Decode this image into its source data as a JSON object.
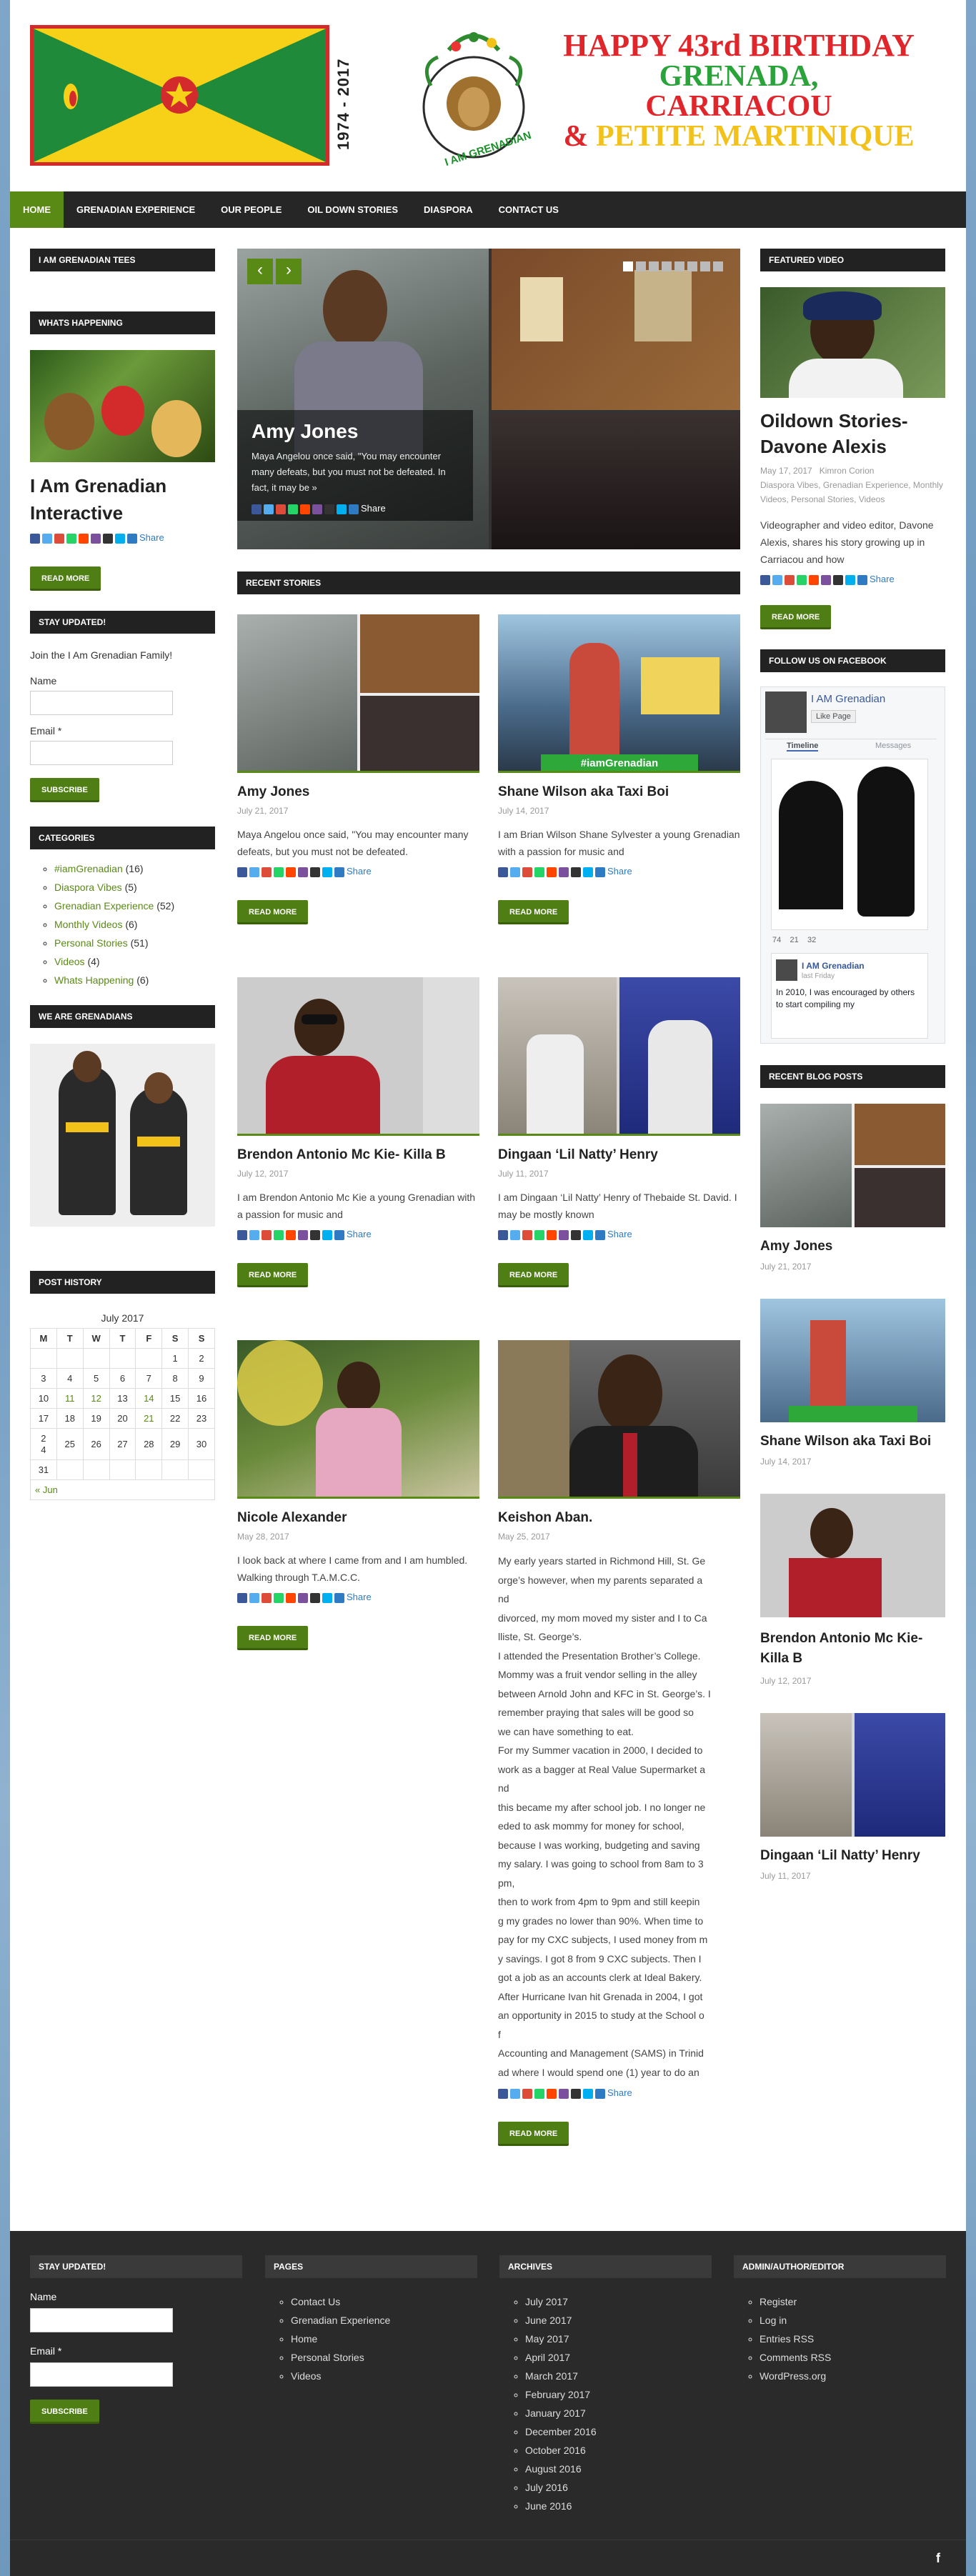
{
  "header": {
    "years": "1974 - 2017",
    "logo_text": "I AM GRENADIAN",
    "bday_line1": "HAPPY 43rd BIRTHDAY",
    "bday_line2": "GRENADA,",
    "bday_line3": "CARRIACOU",
    "bday_amp": "&",
    "bday_line4": "PETITE MARTINIQUE"
  },
  "nav": [
    "HOME",
    "GRENADIAN EXPERIENCE",
    "OUR PEOPLE",
    "OIL DOWN STORIES",
    "DIASPORA",
    "CONTACT US"
  ],
  "left": {
    "tees_title": "I AM GRENADIAN TEES",
    "happening_title": "WHATS HAPPENING",
    "happening_post": "I Am Grenadian Interactive",
    "share": "Share",
    "read_more": "READ MORE",
    "stay_title": "STAY UPDATED!",
    "stay_text": "Join the I Am Grenadian Family!",
    "name_label": "Name",
    "email_label": "Email *",
    "subscribe": "SUBSCRIBE",
    "categories_title": "CATEGORIES",
    "categories": [
      {
        "name": "#iamGrenadian",
        "count": "(16)"
      },
      {
        "name": "Diaspora Vibes",
        "count": "(5)"
      },
      {
        "name": "Grenadian Experience",
        "count": "(52)"
      },
      {
        "name": "Monthly Videos",
        "count": "(6)"
      },
      {
        "name": "Personal Stories",
        "count": "(51)"
      },
      {
        "name": "Videos",
        "count": "(4)"
      },
      {
        "name": "Whats Happening",
        "count": "(6)"
      }
    ],
    "we_are_title": "WE ARE GRENADIANS",
    "post_history_title": "POST HISTORY",
    "calendar": {
      "caption": "July 2017",
      "days": [
        "M",
        "T",
        "W",
        "T",
        "F",
        "S",
        "S"
      ],
      "rows": [
        [
          "",
          "",
          "",
          "",
          "",
          "1",
          "2"
        ],
        [
          "3",
          "4",
          "5",
          "6",
          "7",
          "8",
          "9"
        ],
        [
          "10",
          "11",
          "12",
          "13",
          "14",
          "15",
          "16"
        ],
        [
          "17",
          "18",
          "19",
          "20",
          "21",
          "22",
          "23"
        ],
        [
          "2\n4",
          "25",
          "26",
          "27",
          "28",
          "29",
          "30"
        ],
        [
          "31",
          "",
          "",
          "",
          "",
          "",
          ""
        ]
      ],
      "prev": "« Jun"
    }
  },
  "slider": {
    "title": "Amy Jones",
    "excerpt": "Maya Angelou once said, \"You may encounter many defeats, but you must not be defeated. In fact, it may be »",
    "share": "Share",
    "prev": "‹",
    "next": "›"
  },
  "recent_title": "RECENT STORIES",
  "posts": [
    {
      "title": "Amy Jones",
      "date": "July 21, 2017",
      "excerpt": "Maya Angelou once said, \"You may encounter many defeats, but you must not be defeated.",
      "caption": ""
    },
    {
      "title": "Shane Wilson aka Taxi Boi",
      "date": "July 14, 2017",
      "excerpt": "I am Brian Wilson Shane Sylvester a young Grenadian with a passion for music and",
      "caption": "#iamGrenadian"
    },
    {
      "title": "Brendon Antonio Mc Kie- Killa B",
      "date": "July 12, 2017",
      "excerpt": "I am Brendon Antonio Mc Kie a young Grenadian with a passion for music and",
      "caption": ""
    },
    {
      "title": "Dingaan ‘Lil Natty’ Henry",
      "date": "July 11, 2017",
      "excerpt": "I am Dingaan ‘Lil Natty’ Henry of Thebaide St. David. I may be mostly known",
      "caption": ""
    },
    {
      "title": "Nicole Alexander",
      "date": "May 28, 2017",
      "excerpt": "I look back at where I came from and I am humbled. Walking through T.A.M.C.C.",
      "caption": ""
    },
    {
      "title": "Keishon Aban.",
      "date": "May 25, 2017",
      "excerpt": "",
      "caption": ""
    }
  ],
  "keishon_lines": [
    "My early years started in Richmond Hill, St. Ge",
    "orge’s however, when my parents separated a",
    "nd",
    "divorced, my mom moved my sister and I to Ca",
    "lliste, St. George’s.",
    "I attended the Presentation Brother’s College.",
    "Mommy was a fruit vendor selling in the alley",
    "between Arnold John and KFC in St. George’s. I",
    " remember praying that sales will be good so",
    "we can have something to eat.",
    "For my Summer vacation in 2000, I decided to",
    "work as a bagger at Real Value Supermarket a",
    "nd",
    "this became my after school job. I no longer ne",
    "eded to ask mommy for money for school,",
    "because I was working, budgeting and saving",
    "my salary. I was going to school from 8am to 3",
    "pm,",
    "then to work from 4pm to 9pm and still keepin",
    "g my grades no lower than 90%. When time to",
    "pay for my CXC subjects, I used money from m",
    "y savings. I got 8 from 9 CXC subjects. Then I",
    "got a job as an accounts clerk at Ideal Bakery.",
    "After Hurricane Ivan hit Grenada in 2004, I got",
    "an opportunity in 2015 to study at the School o",
    "f",
    "Accounting and Management (SAMS) in Trinid",
    "ad where I would spend one (1) year to do an"
  ],
  "right": {
    "featured_title": "FEATURED VIDEO",
    "featured_post": "Oildown Stories- Davone Alexis",
    "featured_date": "May 17, 2017",
    "featured_author": "Kimron Corion",
    "featured_cats": "Diaspora Vibes, Grenadian Experience, Monthly Videos, Personal Stories, Videos",
    "featured_excerpt": "Videographer and video editor, Davone Alexis, shares his story growing up in Carriacou and how",
    "follow_title": "FOLLOW US ON FACEBOOK",
    "fb_page": "I AM Grenadian",
    "fb_like": "Like Page",
    "fb_tab1": "Timeline",
    "fb_tab2": "Messages",
    "fb_stats": [
      "74",
      "21",
      "32"
    ],
    "fb_post_name": "I AM Grenadian",
    "fb_post_time": "last Friday",
    "fb_post_text": "In 2010, I was encouraged by others to start compiling my",
    "recent_blog_title": "RECENT BLOG POSTS",
    "blog": [
      {
        "title": "Amy Jones",
        "date": "July 21, 2017"
      },
      {
        "title": "Shane Wilson aka Taxi Boi",
        "date": "July 14, 2017"
      },
      {
        "title": "Brendon Antonio Mc Kie- Killa B",
        "date": "July 12, 2017"
      },
      {
        "title": "Dingaan ‘Lil Natty’ Henry",
        "date": "July 11, 2017"
      }
    ]
  },
  "footer": {
    "stay_title": "STAY UPDATED!",
    "name_label": "Name",
    "email_label": "Email *",
    "subscribe": "SUBSCRIBE",
    "pages_title": "PAGES",
    "pages": [
      "Contact Us",
      "Grenadian Experience",
      "Home",
      "Personal Stories",
      "Videos"
    ],
    "archives_title": "ARCHIVES",
    "archives": [
      "July 2017",
      "June 2017",
      "May 2017",
      "April 2017",
      "March 2017",
      "February 2017",
      "January 2017",
      "December 2016",
      "October 2016",
      "August 2016",
      "July 2016",
      "June 2016"
    ],
    "admin_title": "ADMIN/AUTHOR/EDITOR",
    "admin": [
      "Register",
      "Log in",
      "Entries RSS",
      "Comments RSS",
      "WordPress.org"
    ],
    "fb_icon": "f"
  },
  "colors": {
    "accent": "#5a8a16",
    "dark": "#222222",
    "flag_red": "#d32b2b",
    "flag_green": "#1e8a3a",
    "flag_yellow": "#f7d117"
  }
}
